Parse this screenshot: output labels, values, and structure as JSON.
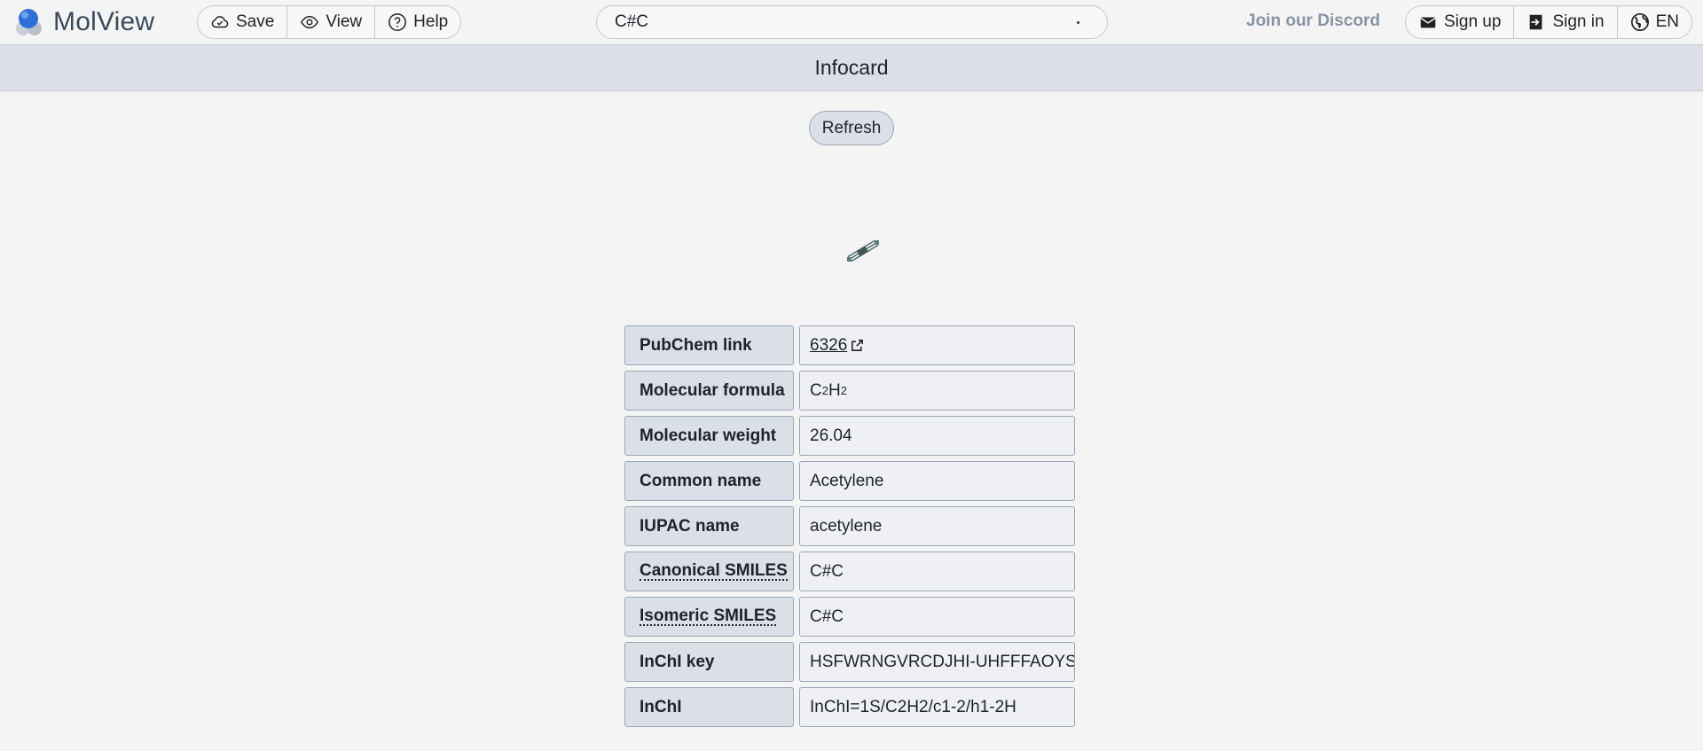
{
  "app": {
    "name": "MolView"
  },
  "toolbar": {
    "save": "Save",
    "view": "View",
    "help": "Help"
  },
  "search": {
    "value": "C#C"
  },
  "header": {
    "discord": "Join our Discord",
    "signup": "Sign up",
    "signin": "Sign in",
    "lang": "EN"
  },
  "infocard": {
    "title": "Infocard",
    "refresh": "Refresh"
  },
  "rows": [
    {
      "label": "PubChem link",
      "value": "6326"
    },
    {
      "label": "Molecular formula",
      "value": "C",
      "sub1": "2",
      "mid": "H",
      "sub2": "2"
    },
    {
      "label": "Molecular weight",
      "value": "26.04"
    },
    {
      "label": "Common name",
      "value": "Acetylene"
    },
    {
      "label": "IUPAC name",
      "value": "acetylene"
    },
    {
      "label": "Canonical SMILES",
      "value": "C#C"
    },
    {
      "label": "Isomeric SMILES",
      "value": "C#C"
    },
    {
      "label": "InChI key",
      "value": "HSFWRNGVRCDJHI-UHFFFAOYSA-N"
    },
    {
      "label": "InChI",
      "value": "InChI=1S/C2H2/c1-2/h1-2H"
    }
  ],
  "icons": {
    "logo": "molview-logo-icon",
    "save": "cloud-check-icon",
    "view": "eye-icon",
    "help": "question-circle-icon",
    "signup": "envelope-icon",
    "signin": "sign-in-icon",
    "lang": "globe-icon",
    "external": "external-link-icon"
  },
  "colors": {
    "accent": "#2f6fd6",
    "infobar": "#dbe0e6",
    "background": "#f4f4f4"
  }
}
